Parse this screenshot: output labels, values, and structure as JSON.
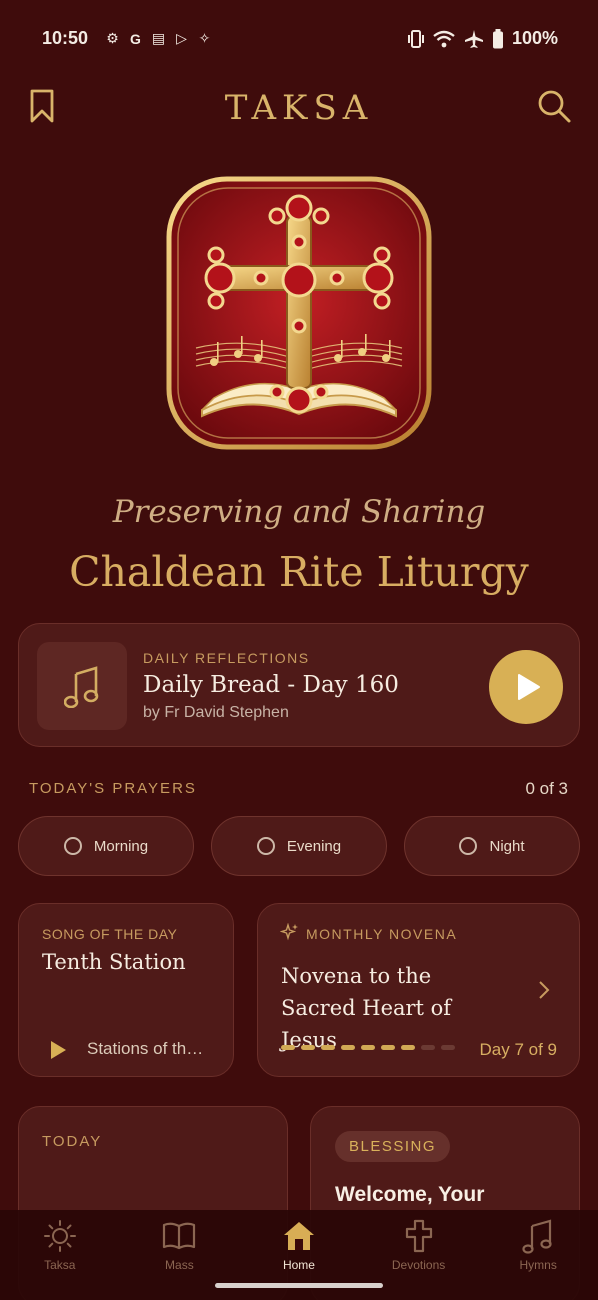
{
  "status_bar": {
    "time": "10:50",
    "left_icons": [
      "settings-icon",
      "google-icon",
      "news-icon",
      "play-store-icon",
      "assistant-icon"
    ],
    "right_icons": [
      "vibrate-icon",
      "wifi-icon",
      "airplane-icon",
      "battery-icon"
    ],
    "battery": "100%"
  },
  "header": {
    "title": "TAKSA",
    "left_icon": "bookmark-icon",
    "right_icon": "search-icon"
  },
  "hero": {
    "logo": "cross-book-logo",
    "subtitle": "Preserving and Sharing",
    "title": "Chaldean Rite Liturgy"
  },
  "reflection": {
    "eyebrow": "DAILY REFLECTIONS",
    "title": "Daily Bread - Day 160",
    "author": "by Fr David Stephen",
    "icon": "music-note-icon"
  },
  "prayers": {
    "label": "TODAY'S PRAYERS",
    "count": "0 of 3",
    "items": [
      {
        "label": "Morning"
      },
      {
        "label": "Evening"
      },
      {
        "label": "Night"
      }
    ]
  },
  "song": {
    "eyebrow": "SONG OF THE DAY",
    "title": "Tenth Station",
    "subtitle": "Stations of the Cross"
  },
  "novena": {
    "eyebrow": "MONTHLY NOVENA",
    "title": "Novena to the Sacred Heart of Jesus",
    "progress_done": 7,
    "progress_total": 9,
    "day_label": "Day 7 of 9"
  },
  "today": {
    "label": "TODAY"
  },
  "blessing": {
    "badge": "BLESSING",
    "title": "Welcome, Your"
  },
  "nav": {
    "items": [
      {
        "label": "Taksa",
        "icon": "sun-icon"
      },
      {
        "label": "Mass",
        "icon": "book-icon"
      },
      {
        "label": "Home",
        "icon": "home-icon",
        "active": true
      },
      {
        "label": "Devotions",
        "icon": "cross-icon"
      },
      {
        "label": "Hymns",
        "icon": "music-note-icon"
      }
    ]
  },
  "colors": {
    "background": "#3f0c0c",
    "card": "#4f1a18",
    "gold": "#d8b055",
    "eyebrow": "#c79b60"
  }
}
